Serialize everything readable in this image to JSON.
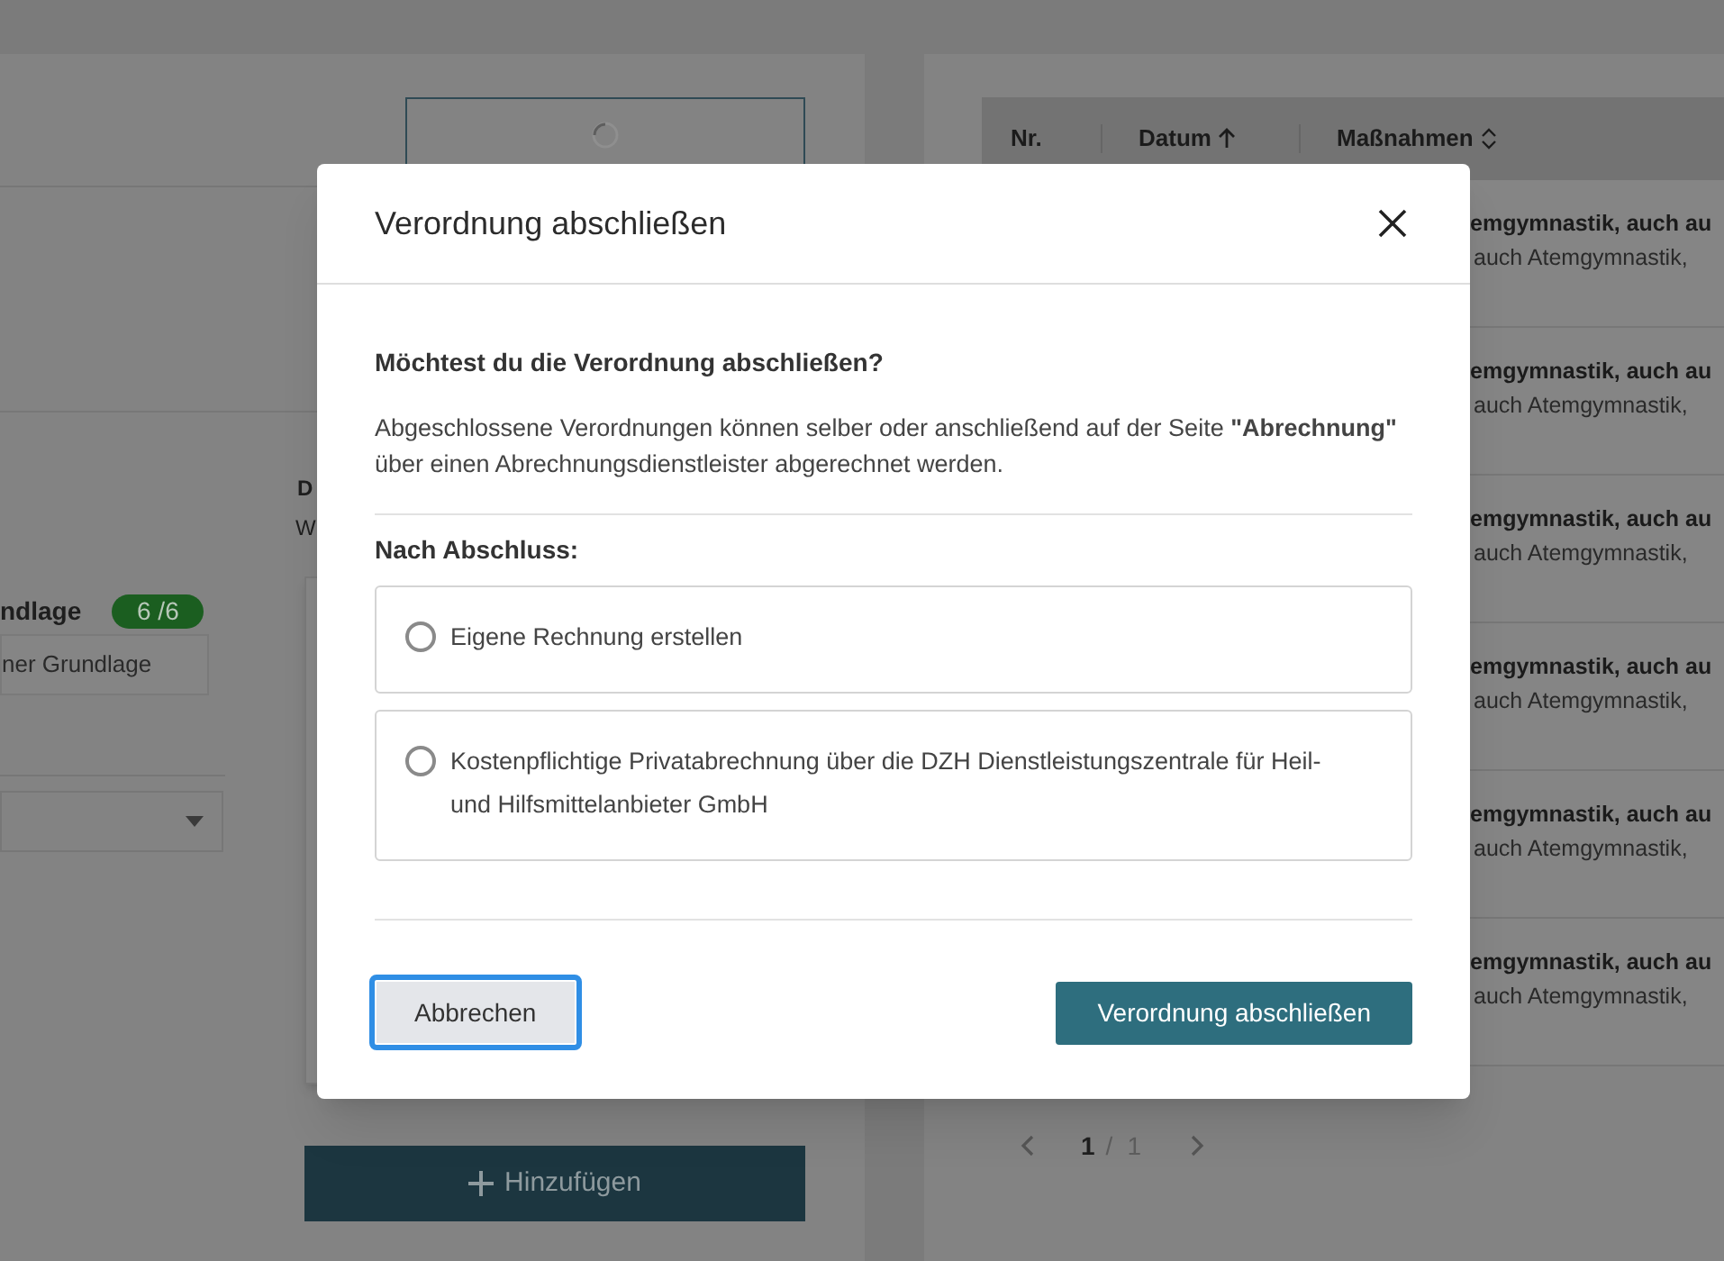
{
  "background": {
    "left_panel": {
      "grundlage_label": "ndlage",
      "grundlage_count": "6 /6",
      "grundlage_value": "ner Grundlage",
      "detail_heading": "D",
      "detail_text": "W",
      "add_button": "Hinzufügen"
    },
    "right_panel": {
      "table": {
        "columns": [
          {
            "label": "Nr.",
            "kind": "plain"
          },
          {
            "label": "Datum",
            "kind": "ascending"
          },
          {
            "label": "Maßnahmen",
            "kind": "sortable"
          }
        ],
        "rows": [
          {
            "title": "emgymnastik, auch au",
            "subtitle": "auch Atemgymnastik,"
          },
          {
            "title": "emgymnastik, auch au",
            "subtitle": "auch Atemgymnastik,"
          },
          {
            "title": "emgymnastik, auch au",
            "subtitle": "auch Atemgymnastik,"
          },
          {
            "title": "emgymnastik, auch au",
            "subtitle": "auch Atemgymnastik,"
          },
          {
            "title": "emgymnastik, auch au",
            "subtitle": "auch Atemgymnastik,"
          },
          {
            "title": "emgymnastik, auch au",
            "subtitle": "auch Atemgymnastik,"
          }
        ]
      },
      "pagination": {
        "current": "1",
        "separator": "/",
        "total": "1"
      }
    }
  },
  "dialog": {
    "title": "Verordnung abschließen",
    "question": "Möchtest du die Verordnung abschließen?",
    "text": "Abgeschlossene Verordnungen können selber oder anschließend auf der Seite **\"Abrechnung\"** über einen Abrechnungsdienstleister abgerechnet werden.",
    "options_label": "Nach Abschluss:",
    "options": [
      {
        "label": "Eigene Rechnung erstellen",
        "selected": false
      },
      {
        "label": "Kostenpflichtige Privatabrechnung über die DZH Dienstleistungszentrale für Heil- und Hilfsmittelanbieter GmbH",
        "selected": false
      }
    ],
    "cancel_button": "Abbrechen",
    "confirm_button": "Verordnung abschließen"
  }
}
